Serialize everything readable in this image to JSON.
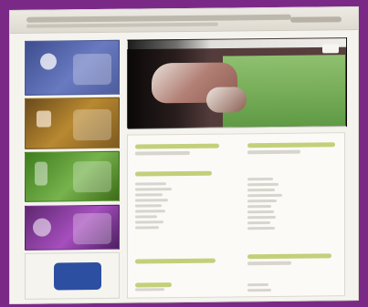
{
  "page": {
    "background_color": "#7a2a86",
    "frame_color": "#f4f3ee"
  },
  "tiles": [
    {
      "icon": "sports-icon",
      "accent": "#5c6db5"
    },
    {
      "icon": "trophy-icon",
      "accent": "#b98931"
    },
    {
      "icon": "ball-icon",
      "accent": "#77b34d"
    },
    {
      "icon": "helmet-icon",
      "accent": "#a64fbe"
    },
    {
      "icon": "jersey-icon",
      "accent": "#2d4fa1"
    }
  ],
  "hero": {
    "accent": "#78ad59"
  }
}
